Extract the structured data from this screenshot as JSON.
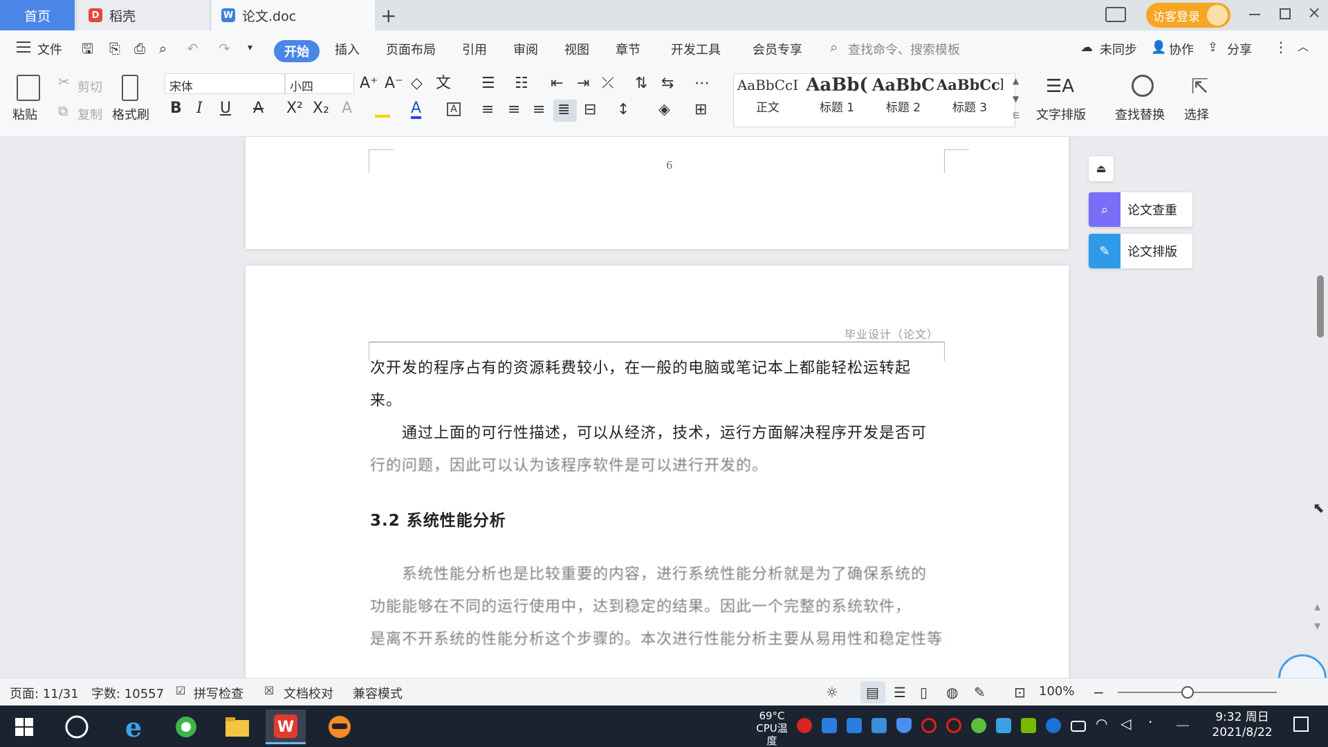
{
  "tabs": {
    "home": "首页",
    "daoke": "稻壳",
    "doc": "论文.doc",
    "visitor": "访客登录"
  },
  "menu": {
    "file": "文件",
    "start": "开始",
    "insert": "插入",
    "layout": "页面布局",
    "reference": "引用",
    "review": "审阅",
    "view": "视图",
    "chapter": "章节",
    "devtools": "开发工具",
    "member": "会员专享",
    "search_placeholder": "查找命令、搜索模板",
    "sync": "未同步",
    "collab": "协作",
    "share": "分享"
  },
  "ribbon": {
    "paste": "粘贴",
    "cut": "剪切",
    "copy": "复制",
    "format_painter": "格式刷",
    "font": "宋体",
    "size": "小四",
    "styles": [
      {
        "sample": "AaBbCcI",
        "name": "正文"
      },
      {
        "sample": "AaBb(",
        "name": "标题 1"
      },
      {
        "sample": "AaBbC",
        "name": "标题 2"
      },
      {
        "sample": "AaBbCcl",
        "name": "标题 3"
      }
    ],
    "text_layout": "文字排版",
    "find_replace": "查找替换",
    "select": "选择"
  },
  "document": {
    "page_number": "6",
    "header": "毕业设计（论文）",
    "line1": "次开发的程序占有的资源耗费较小，在一般的电脑或笔记本上都能轻松运转起",
    "line2": "来。",
    "line3": "通过上面的可行性描述，可以从经济，技术，运行方面解决程序开发是否可",
    "line4": "行的问题，因此可以认为该程序软件是可以进行开发的。",
    "heading": "3.2  系统性能分析",
    "line5": "系统性能分析也是比较重要的内容，进行系统性能分析就是为了确保系统的",
    "line6": "功能能够在不同的运行使用中，达到稳定的结果。因此一个完整的系统软件，",
    "line7": "是离不开系统的性能分析这个步骤的。本次进行性能分析主要从易用性和稳定性等方面"
  },
  "side_panel": {
    "check": "论文查重",
    "format": "论文排版"
  },
  "status": {
    "page": "页面: 11/31",
    "words": "字数: 10557",
    "spell": "拼写检查",
    "proof": "文档校对",
    "compat": "兼容模式",
    "zoom": "100%"
  },
  "taskbar": {
    "cpu_temp": "69°C",
    "cpu_label": "CPU温度",
    "time": "9:32 周日",
    "date": "2021/8/22"
  },
  "colors": {
    "accent": "#4a86e8",
    "visitor": "#f5a623",
    "taskbar": "#1b2331"
  }
}
